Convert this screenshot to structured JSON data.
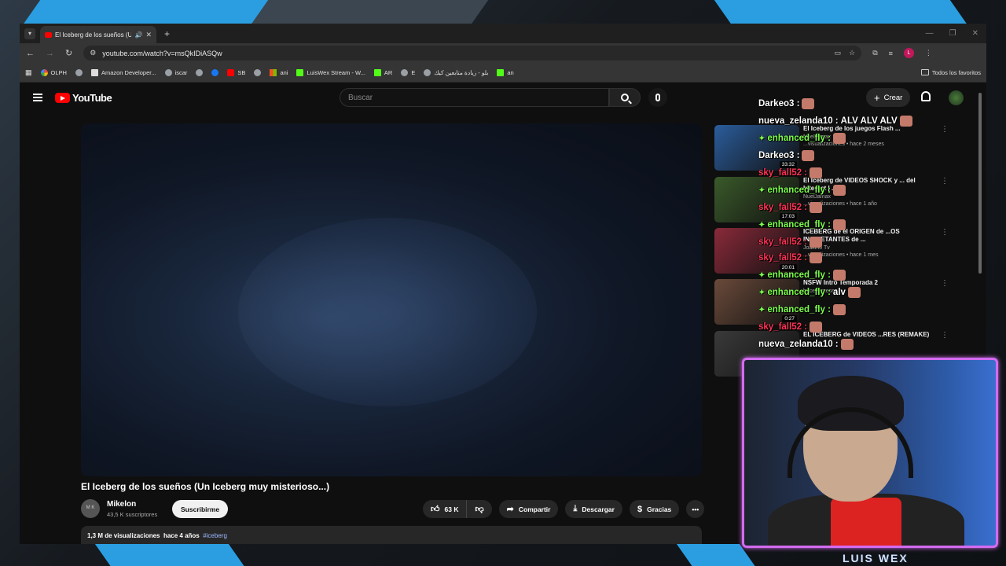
{
  "browser": {
    "tab_title": "El Iceberg de los sueños (U",
    "url": "youtube.com/watch?v=msQkIDiASQw",
    "bookmarks": [
      "OLPH",
      "Amazon Developer...",
      "iscar",
      "",
      "SB",
      "",
      "ani",
      "LuisWex Stream - W...",
      "AR",
      "E",
      "بلو - زيادة متابعين كيك",
      "an"
    ],
    "bookmarks_folder": "Todos los favoritos"
  },
  "youtube": {
    "logo_text": "YouTube",
    "search_placeholder": "Buscar",
    "create_label": "Crear",
    "video_title": "El Iceberg de los sueños (Un Iceberg muy misterioso...)",
    "channel_name": "Mikelon",
    "channel_avatar_initials": "M K",
    "subscribers": "43,5 K suscriptores",
    "subscribe_label": "Suscribirme",
    "likes": "63 K",
    "share_label": "Compartir",
    "download_label": "Descargar",
    "thanks_label": "Gracias",
    "views": "1,3 M de visualizaciones",
    "age": "hace 4 años",
    "hashtag": "#iceberg"
  },
  "recommendations": [
    {
      "title": "El Iceberg de los juegos Flash ...",
      "channel": "NueDamax",
      "meta": "...visualizaciones • hace 2 meses",
      "duration": "33:32",
      "color": "#2b5d9c"
    },
    {
      "title": "El Iceberg de VIDEOS SHOCK y ... del Internet | ...",
      "channel": "NueDamax",
      "meta": "...visualizaciones • hace 1 año",
      "duration": "17:03",
      "color": "#3a5a2a"
    },
    {
      "title": "ICEBERG de el ORIGEN de ...OS INQUIETANTES de ...",
      "channel": "Joakino Tv",
      "meta": "...visualizaciones • hace 1 mes",
      "duration": "20:01",
      "color": "#8a2a3a"
    },
    {
      "title": "NSFW Intro Temporada 2",
      "channel": "",
      "meta": "hace 6 meses",
      "duration": "0:27",
      "color": "#6a4a3a"
    },
    {
      "title": "EL ICEBERG de VIDEOS ...RES (REMAKE)",
      "channel": "",
      "meta": "",
      "duration": "",
      "color": "#3a3a3a"
    }
  ],
  "chat": [
    {
      "user": "Darkeo3",
      "msg": "",
      "color": "white",
      "badge": false
    },
    {
      "user": "nueva_zelanda10",
      "msg": "ALV  ALV  ALV",
      "color": "white",
      "badge": false
    },
    {
      "user": "enhanced_fly",
      "msg": "",
      "color": "green",
      "badge": true
    },
    {
      "user": "Darkeo3",
      "msg": "",
      "color": "white",
      "badge": false
    },
    {
      "user": "sky_fall52",
      "msg": "",
      "color": "red",
      "badge": false
    },
    {
      "user": "enhanced_fly",
      "msg": "",
      "color": "green",
      "badge": true
    },
    {
      "user": "sky_fall52",
      "msg": "",
      "color": "red",
      "badge": false
    },
    {
      "user": "enhanced_fly",
      "msg": "",
      "color": "green",
      "badge": true
    },
    {
      "user": "sky_fall52",
      "msg": "",
      "color": "red",
      "badge": false
    },
    {
      "user": "sky_fall52",
      "msg": "",
      "color": "red",
      "badge": false
    },
    {
      "user": "enhanced_fly",
      "msg": "",
      "color": "green",
      "badge": true
    },
    {
      "user": "enhanced_fly",
      "msg": "alv",
      "color": "green",
      "badge": true
    },
    {
      "user": "enhanced_fly",
      "msg": "",
      "color": "green",
      "badge": true
    },
    {
      "user": "sky_fall52",
      "msg": "",
      "color": "red",
      "badge": false
    },
    {
      "user": "nueva_zelanda10",
      "msg": "",
      "color": "white",
      "badge": false
    }
  ],
  "streamer_name": "LUIS WEX",
  "colors": {
    "accent": "#2a9ee0",
    "cam_border": "#d46bf0",
    "yt_red": "#ff0000"
  }
}
